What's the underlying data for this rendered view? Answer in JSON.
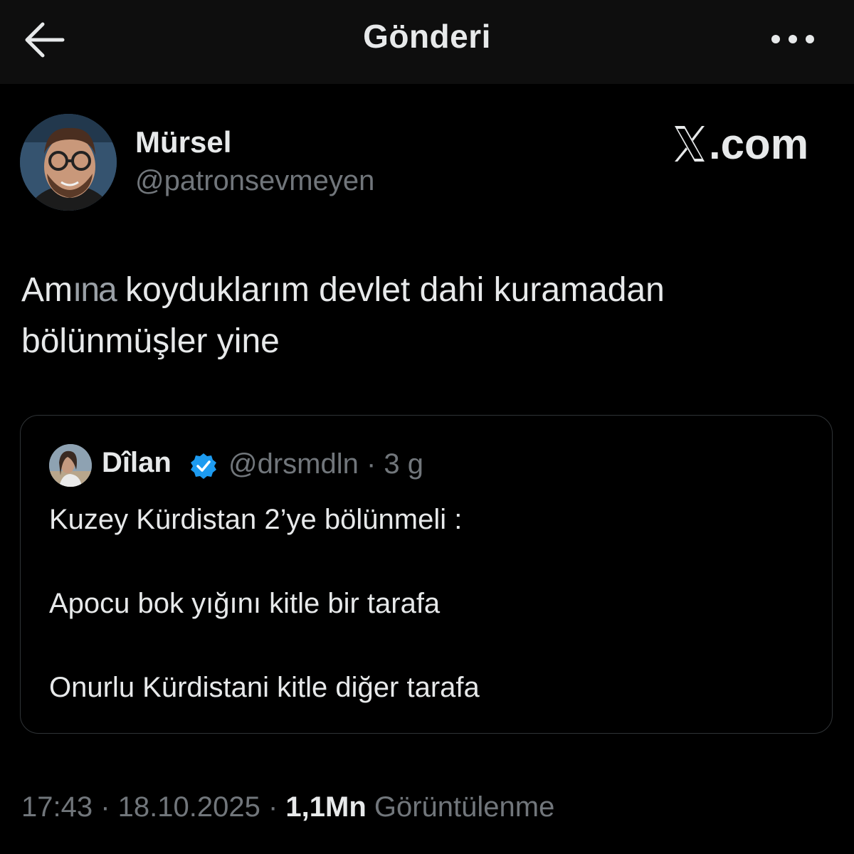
{
  "header": {
    "title": "Gönderi",
    "back_icon": "arrow-left-icon",
    "more_icon": "more-horizontal-icon"
  },
  "post": {
    "author": {
      "display_name": "Mürsel",
      "handle": "@patronsevmeyen"
    },
    "watermark": "X.com",
    "text_line1_prefix": "Am",
    "text_line1_censored": "ına",
    "text_line1_rest": " koyduklarım devlet dahi kuramadan",
    "text_line2": "bölünmüşler yine",
    "timestamp": "17:43 · 18.10.2025 · ",
    "views_count": "1,1Mn",
    "views_label": " Görüntülenme"
  },
  "quoted_post": {
    "display_name": "Dîlan",
    "verified_icon": "verified-badge-icon",
    "handle": "@drsmdln",
    "age": " · 3 g",
    "lines": [
      "Kuzey Kürdistan 2’ye bölünmeli :",
      "Apocu bok yığını kitle bir tarafa",
      "Onurlu Kürdistani kitle diğer tarafa"
    ]
  },
  "colors": {
    "background": "#000000",
    "header_background": "#0e0e0e",
    "text_primary": "#e7e9ea",
    "text_secondary": "#71767b",
    "verified_blue": "#1d9bf0",
    "card_border": "#2f3336"
  }
}
